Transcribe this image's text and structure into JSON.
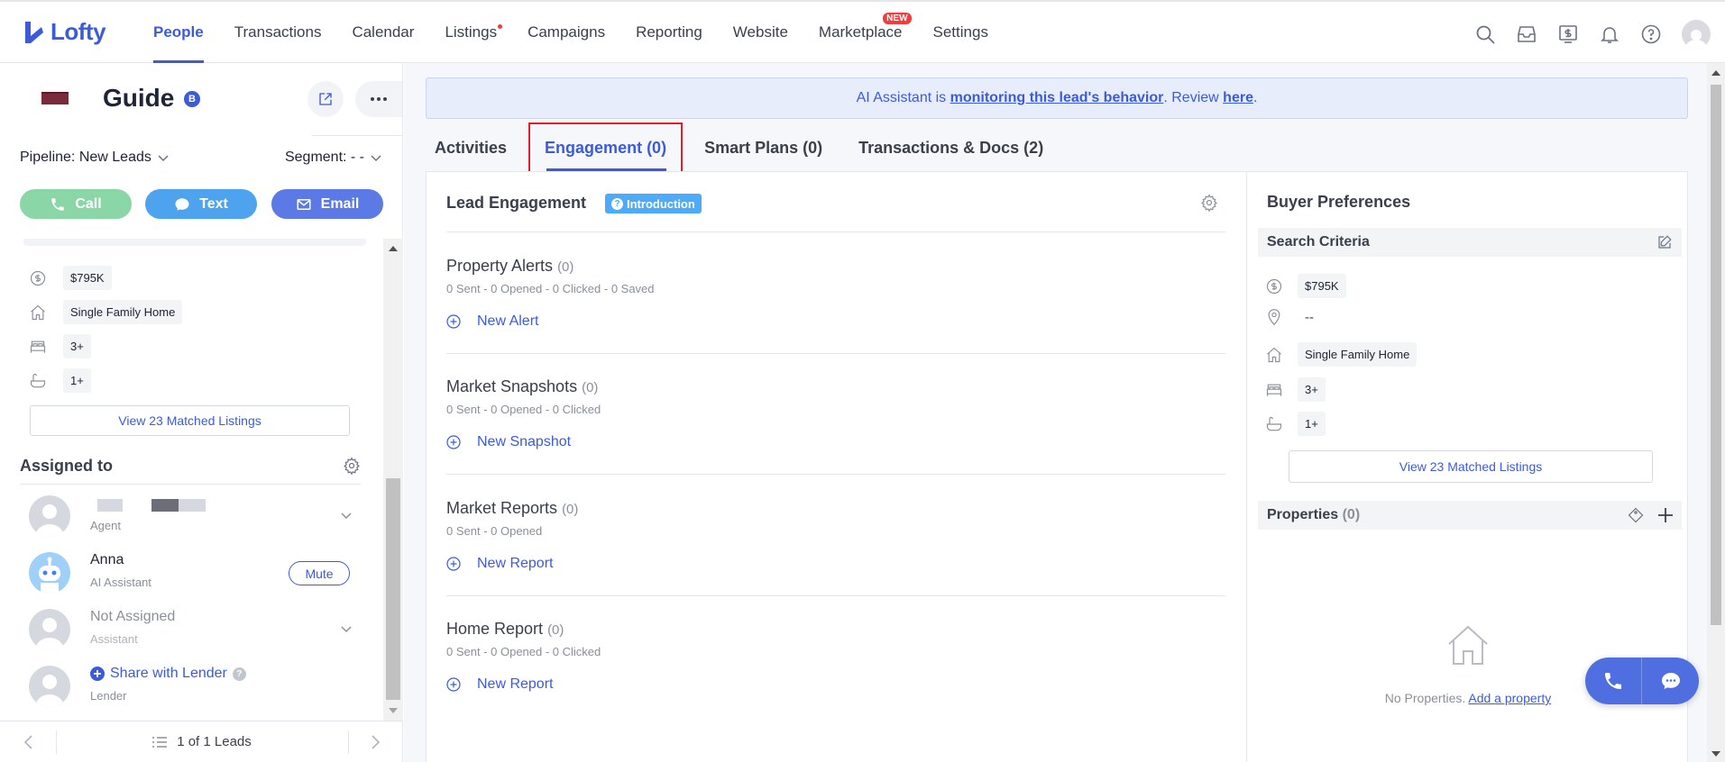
{
  "brand": {
    "name": "Lofty",
    "accent": "#3b5bdb"
  },
  "nav": {
    "items": [
      {
        "label": "People",
        "active": true
      },
      {
        "label": "Transactions"
      },
      {
        "label": "Calendar"
      },
      {
        "label": "Listings"
      },
      {
        "label": "Campaigns"
      },
      {
        "label": "Reporting"
      },
      {
        "label": "Website"
      },
      {
        "label": "Marketplace"
      },
      {
        "label": "Settings"
      }
    ],
    "marketplace_badge": "NEW"
  },
  "lead": {
    "name": "Guide",
    "badge": "B",
    "pipeline": "Pipeline: New Leads",
    "segment": "Segment: - -",
    "actions": {
      "call": "Call",
      "text": "Text",
      "email": "Email"
    }
  },
  "left_criteria": {
    "price": "$795K",
    "home_type": "Single Family Home",
    "beds": "3+",
    "baths": "1+",
    "view_matched": "View 23 Matched Listings"
  },
  "assigned": {
    "title": "Assigned to",
    "agent_role": "Agent",
    "ai": {
      "name": "Anna",
      "role": "AI Assistant",
      "mute": "Mute"
    },
    "assistant": {
      "name": "Not Assigned",
      "role": "Assistant"
    },
    "lender": {
      "name": "Share with Lender",
      "role": "Lender"
    }
  },
  "pager": {
    "label": "1 of 1 Leads"
  },
  "ai_banner": {
    "prefix": "AI Assistant is ",
    "link1": "monitoring this lead's behavior",
    "middle": ". Review ",
    "link2": "here",
    "suffix": "."
  },
  "tabs": [
    {
      "label": "Activities"
    },
    {
      "label": "Engagement (0)",
      "active": true
    },
    {
      "label": "Smart Plans (0)"
    },
    {
      "label": "Transactions & Docs (2)"
    }
  ],
  "engagement": {
    "title": "Lead Engagement",
    "intro": "Introduction",
    "sections": [
      {
        "title": "Property Alerts",
        "count": "(0)",
        "stats": "0 Sent - 0 Opened - 0 Clicked - 0 Saved",
        "link": "New Alert"
      },
      {
        "title": "Market Snapshots",
        "count": "(0)",
        "stats": "0 Sent - 0 Opened - 0 Clicked",
        "link": "New Snapshot"
      },
      {
        "title": "Market Reports",
        "count": "(0)",
        "stats": "0 Sent - 0 Opened",
        "link": "New Report"
      },
      {
        "title": "Home Report",
        "count": "(0)",
        "stats": "0 Sent - 0 Opened - 0 Clicked",
        "link": "New Report"
      }
    ]
  },
  "buyer": {
    "title": "Buyer Preferences",
    "search_criteria": "Search Criteria",
    "price": "$795K",
    "location": "--",
    "home_type": "Single Family Home",
    "beds": "3+",
    "baths": "1+",
    "view_matched": "View 23 Matched Listings",
    "properties": "Properties",
    "properties_count": "(0)",
    "no_props": "No Properties. ",
    "add_property": "Add a property"
  }
}
